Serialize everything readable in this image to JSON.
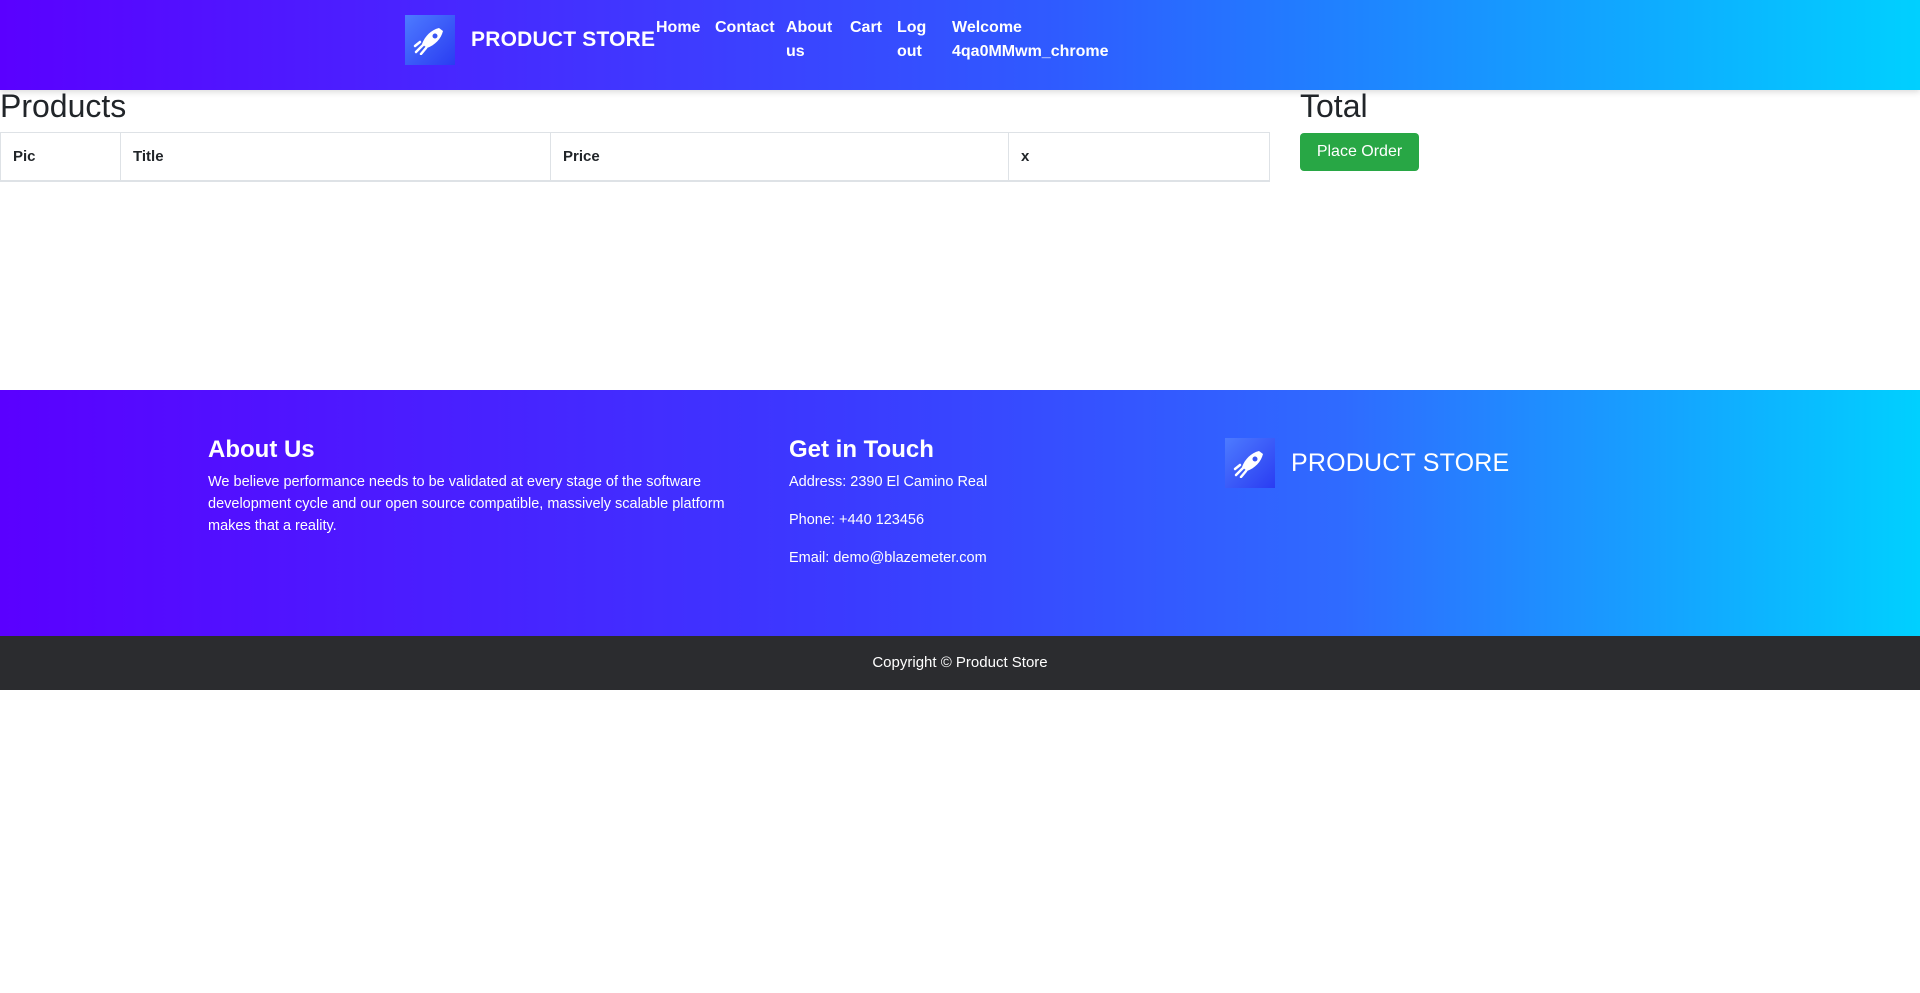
{
  "navbar": {
    "brand": "PRODUCT STORE",
    "logo_icon": "rocket-icon",
    "items": {
      "home": "Home",
      "contact": "Contact",
      "about_l1": "About",
      "about_l2": "us",
      "cart": "Cart",
      "logout_l1": "Log",
      "logout_l2": "out",
      "welcome_l1": "Welcome",
      "welcome_l2": "4qa0MMwm_chrome"
    }
  },
  "main": {
    "products_heading": "Products",
    "total_heading": "Total",
    "table_headers": [
      "Pic",
      "Title",
      "Price",
      "x"
    ],
    "place_order_label": "Place Order"
  },
  "footer": {
    "about_title": "About Us",
    "about_line1": "We believe performance needs to be validated at every stage of the software",
    "about_line2": "development cycle and our open source compatible, massively scalable platform",
    "about_line3": "makes that a reality.",
    "contact_title": "Get in Touch",
    "address": "Address: 2390 El Camino Real",
    "phone": "Phone: +440 123456",
    "email": "Email: demo@blazemeter.com",
    "brand": "PRODUCT STORE",
    "copyright": "Copyright © Product Store"
  },
  "colors": {
    "accent_green": "#28a745",
    "gradient_start": "#5a00ff",
    "gradient_end": "#00d0ff",
    "copyright_bg": "#2b2c2f"
  }
}
